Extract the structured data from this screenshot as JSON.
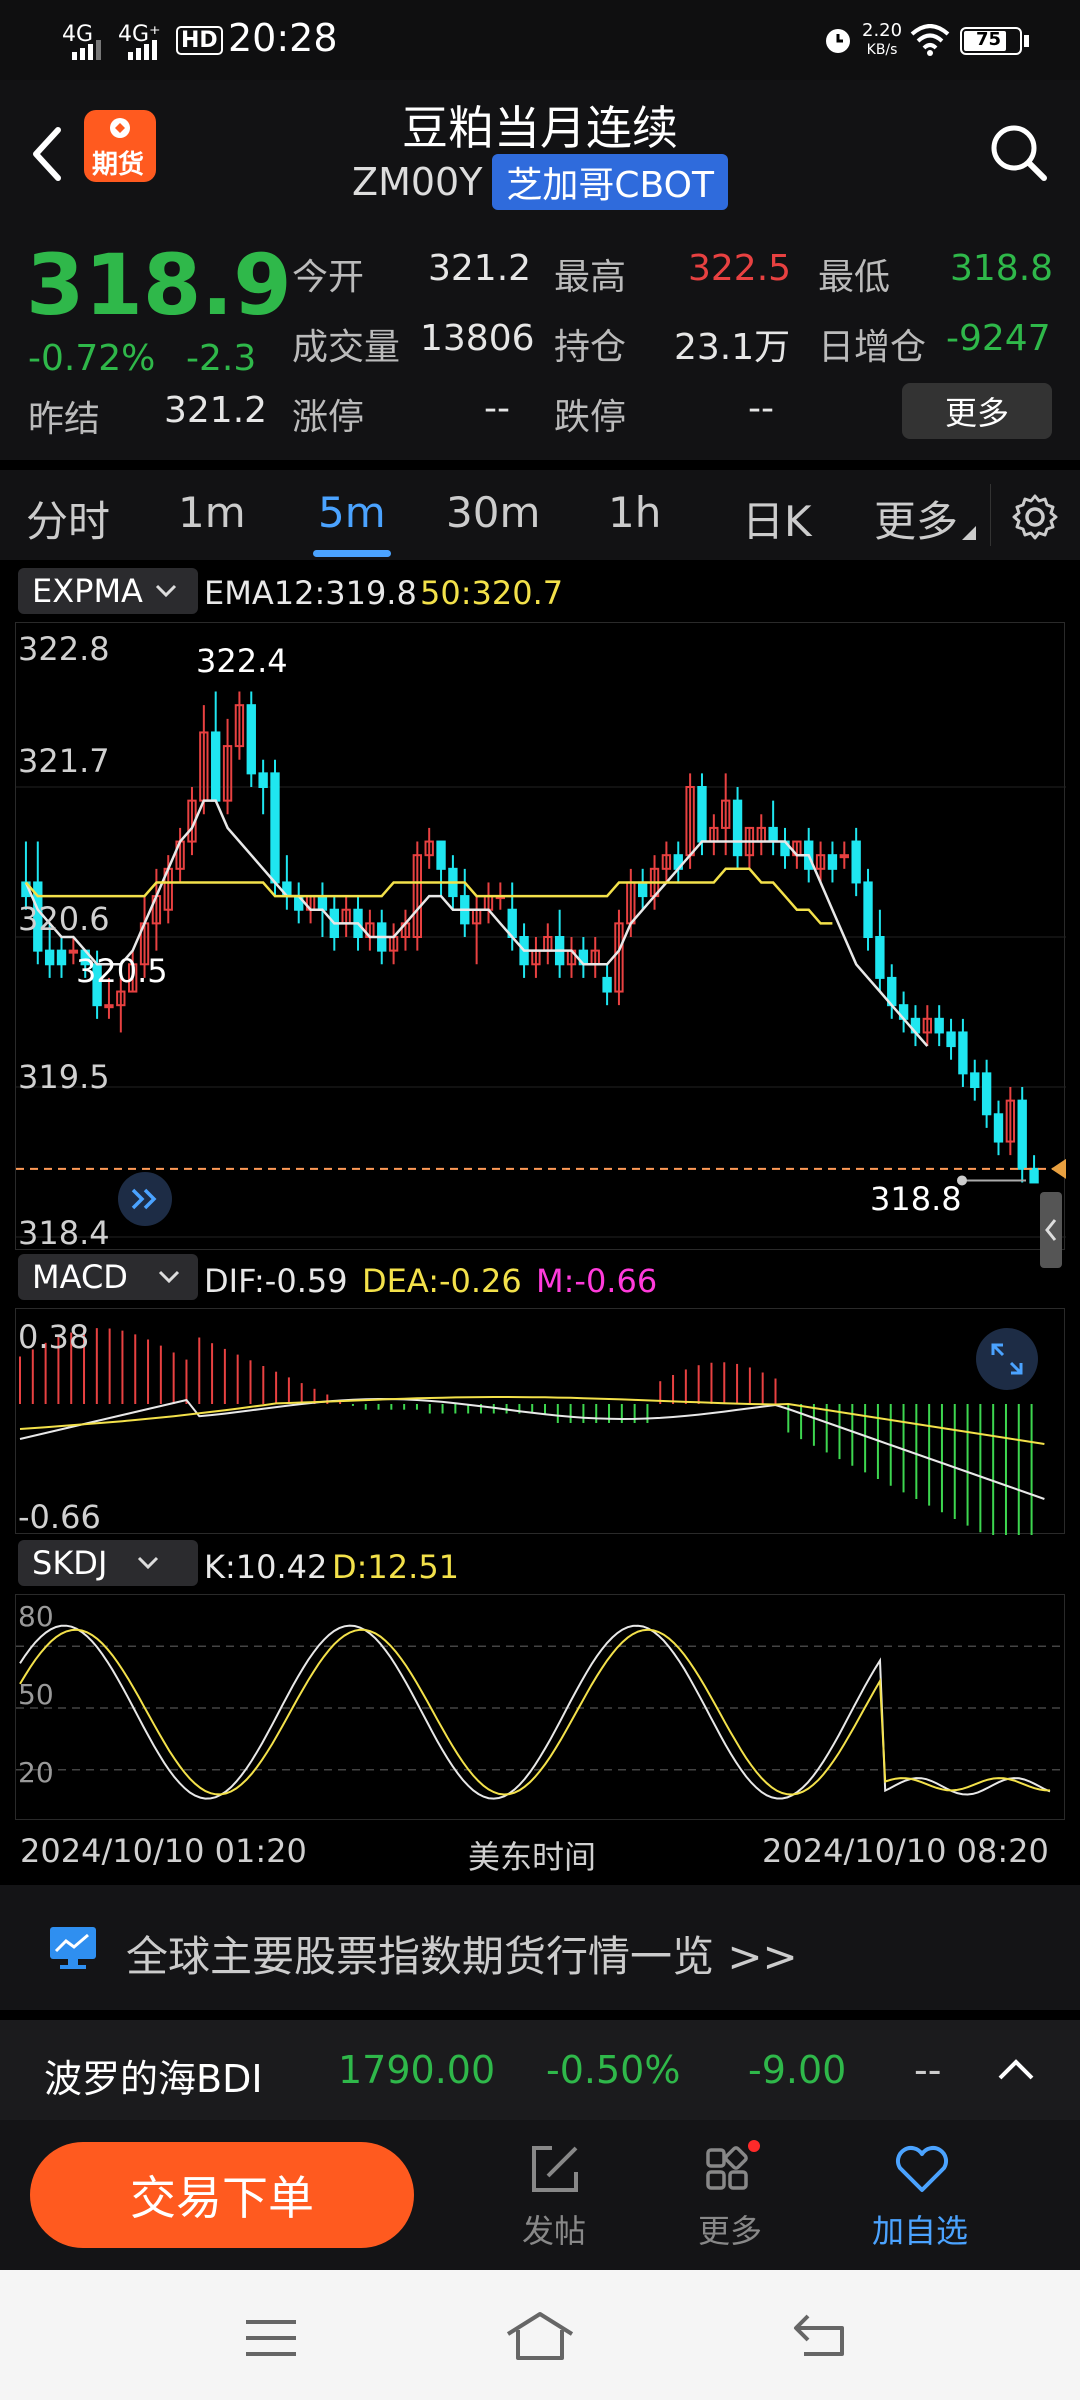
{
  "status_bar": {
    "net1": "4G",
    "net2": "4G⁺",
    "hd": "HD",
    "time": "20:28",
    "speed_value": "2.20",
    "speed_unit": "KB/s",
    "battery": "75"
  },
  "header": {
    "title": "豆粕当月连续",
    "code": "ZM00Y",
    "exchange": "芝加哥CBOT",
    "logo_label": "期货"
  },
  "quote": {
    "price": "318.9",
    "change_pct": "-0.72%",
    "change": "-2.3",
    "prev_settle_label": "昨结",
    "prev_settle": "321.2",
    "open_label": "今开",
    "open": "321.2",
    "high_label": "最高",
    "high": "322.5",
    "low_label": "最低",
    "low": "318.8",
    "volume_label": "成交量",
    "volume": "13806",
    "oi_label": "持仓",
    "oi": "23.1万",
    "oi_change_label": "日增仓",
    "oi_change": "-9247",
    "limit_up_label": "涨停",
    "limit_up": "--",
    "limit_down_label": "跌停",
    "limit_down": "--",
    "more_button": "更多"
  },
  "tabs": [
    "分时",
    "1m",
    "5m",
    "30m",
    "1h",
    "日K",
    "更多"
  ],
  "active_tab": "5m",
  "main_indicator": {
    "name": "EXPMA",
    "ema12_label": "EMA12:319.8",
    "ema50_label": "50:320.7"
  },
  "macd": {
    "name": "MACD",
    "dif": "DIF:-0.59",
    "dea": "DEA:-0.26",
    "m": "M:-0.66",
    "top_label": "0.38",
    "bottom_label": "-0.66"
  },
  "skdj": {
    "name": "SKDJ",
    "k": "K:10.42",
    "d": "D:12.51",
    "levels": [
      "80",
      "50",
      "20"
    ]
  },
  "time_axis": {
    "start": "2024/10/10 01:20",
    "middle": "美东时间",
    "end": "2024/10/10 08:20"
  },
  "colors": {
    "up": "#e84141",
    "down": "#1fe6f0",
    "ema12": "#e8e8e8",
    "ema50": "#f3e14a",
    "accent": "#4ba3ff",
    "green": "#2fb84a",
    "trade_button": "#ff5a1f"
  },
  "chart_data": {
    "type": "candlestick",
    "interval": "5m",
    "y_ticks": [
      "322.8",
      "321.7",
      "320.6",
      "319.5",
      "318.4"
    ],
    "ylim": [
      318.4,
      322.8
    ],
    "high_label": "322.4",
    "low_label": "320.5",
    "last_price_label": "318.8",
    "candles": [
      {
        "o": 321.0,
        "h": 321.3,
        "c": 320.9,
        "l": 320.8
      },
      {
        "o": 321.0,
        "h": 321.3,
        "c": 320.5,
        "l": 320.4
      },
      {
        "o": 320.5,
        "h": 320.7,
        "c": 320.4,
        "l": 320.3
      },
      {
        "o": 320.5,
        "h": 320.6,
        "c": 320.4,
        "l": 320.3
      },
      {
        "o": 320.5,
        "h": 320.6,
        "c": 320.5,
        "l": 320.4
      },
      {
        "o": 320.5,
        "h": 320.5,
        "c": 320.4,
        "l": 320.3
      },
      {
        "o": 320.4,
        "h": 320.5,
        "c": 320.1,
        "l": 320.0
      },
      {
        "o": 320.1,
        "h": 320.3,
        "c": 320.1,
        "l": 320.0
      },
      {
        "o": 320.1,
        "h": 320.3,
        "c": 320.2,
        "l": 319.9
      },
      {
        "o": 320.2,
        "h": 320.5,
        "c": 320.4,
        "l": 320.2
      },
      {
        "o": 320.4,
        "h": 320.9,
        "c": 320.7,
        "l": 320.3
      },
      {
        "o": 320.7,
        "h": 321.1,
        "c": 320.9,
        "l": 320.5
      },
      {
        "o": 320.8,
        "h": 321.2,
        "c": 321.1,
        "l": 320.7
      },
      {
        "o": 321.1,
        "h": 321.4,
        "c": 321.3,
        "l": 321.0
      },
      {
        "o": 321.3,
        "h": 321.7,
        "c": 321.6,
        "l": 321.2
      },
      {
        "o": 321.6,
        "h": 322.3,
        "c": 322.1,
        "l": 321.5
      },
      {
        "o": 322.1,
        "h": 322.4,
        "c": 321.6,
        "l": 321.6
      },
      {
        "o": 321.6,
        "h": 322.2,
        "c": 322.0,
        "l": 321.5
      },
      {
        "o": 322.0,
        "h": 322.4,
        "c": 322.3,
        "l": 321.9
      },
      {
        "o": 322.3,
        "h": 322.4,
        "c": 321.8,
        "l": 321.7
      },
      {
        "o": 321.8,
        "h": 321.9,
        "c": 321.7,
        "l": 321.5
      },
      {
        "o": 321.8,
        "h": 321.9,
        "c": 321.0,
        "l": 320.9
      },
      {
        "o": 321.0,
        "h": 321.2,
        "c": 320.9,
        "l": 320.8
      },
      {
        "o": 320.9,
        "h": 321.0,
        "c": 320.8,
        "l": 320.7
      },
      {
        "o": 320.8,
        "h": 320.9,
        "c": 320.9,
        "l": 320.7
      },
      {
        "o": 320.9,
        "h": 321.0,
        "c": 320.8,
        "l": 320.6
      },
      {
        "o": 320.8,
        "h": 320.9,
        "c": 320.6,
        "l": 320.5
      },
      {
        "o": 320.7,
        "h": 320.9,
        "c": 320.8,
        "l": 320.6
      },
      {
        "o": 320.8,
        "h": 320.9,
        "c": 320.6,
        "l": 320.5
      },
      {
        "o": 320.6,
        "h": 320.8,
        "c": 320.7,
        "l": 320.5
      },
      {
        "o": 320.7,
        "h": 320.8,
        "c": 320.5,
        "l": 320.4
      },
      {
        "o": 320.5,
        "h": 320.7,
        "c": 320.6,
        "l": 320.4
      },
      {
        "o": 320.6,
        "h": 320.8,
        "c": 320.7,
        "l": 320.5
      },
      {
        "o": 320.6,
        "h": 321.3,
        "c": 321.2,
        "l": 320.5
      },
      {
        "o": 321.2,
        "h": 321.4,
        "c": 321.3,
        "l": 321.1
      },
      {
        "o": 321.3,
        "h": 321.3,
        "c": 321.1,
        "l": 320.9
      },
      {
        "o": 321.1,
        "h": 321.2,
        "c": 320.9,
        "l": 320.8
      },
      {
        "o": 320.9,
        "h": 321.1,
        "c": 320.7,
        "l": 320.6
      },
      {
        "o": 320.7,
        "h": 320.9,
        "c": 320.8,
        "l": 320.4
      },
      {
        "o": 320.8,
        "h": 321.0,
        "c": 320.9,
        "l": 320.7
      },
      {
        "o": 320.9,
        "h": 321.0,
        "c": 320.9,
        "l": 320.8
      },
      {
        "o": 320.8,
        "h": 321.0,
        "c": 320.6,
        "l": 320.5
      },
      {
        "o": 320.6,
        "h": 320.7,
        "c": 320.4,
        "l": 320.3
      },
      {
        "o": 320.4,
        "h": 320.6,
        "c": 320.5,
        "l": 320.3
      },
      {
        "o": 320.5,
        "h": 320.7,
        "c": 320.6,
        "l": 320.4
      },
      {
        "o": 320.6,
        "h": 320.8,
        "c": 320.4,
        "l": 320.3
      },
      {
        "o": 320.4,
        "h": 320.6,
        "c": 320.5,
        "l": 320.3
      },
      {
        "o": 320.5,
        "h": 320.6,
        "c": 320.4,
        "l": 320.3
      },
      {
        "o": 320.4,
        "h": 320.6,
        "c": 320.5,
        "l": 320.3
      },
      {
        "o": 320.3,
        "h": 320.4,
        "c": 320.2,
        "l": 320.1
      },
      {
        "o": 320.2,
        "h": 320.8,
        "c": 320.7,
        "l": 320.1
      },
      {
        "o": 320.7,
        "h": 321.1,
        "c": 321.0,
        "l": 320.6
      },
      {
        "o": 321.0,
        "h": 321.1,
        "c": 320.9,
        "l": 320.8
      },
      {
        "o": 320.9,
        "h": 321.2,
        "c": 321.1,
        "l": 320.8
      },
      {
        "o": 321.1,
        "h": 321.3,
        "c": 321.2,
        "l": 321.0
      },
      {
        "o": 321.2,
        "h": 321.3,
        "c": 321.1,
        "l": 321.0
      },
      {
        "o": 321.2,
        "h": 321.8,
        "c": 321.7,
        "l": 321.1
      },
      {
        "o": 321.7,
        "h": 321.8,
        "c": 321.3,
        "l": 321.2
      },
      {
        "o": 321.3,
        "h": 321.5,
        "c": 321.4,
        "l": 321.2
      },
      {
        "o": 321.4,
        "h": 321.8,
        "c": 321.6,
        "l": 321.2
      },
      {
        "o": 321.6,
        "h": 321.7,
        "c": 321.2,
        "l": 321.1
      },
      {
        "o": 321.2,
        "h": 321.4,
        "c": 321.4,
        "l": 321.1
      },
      {
        "o": 321.3,
        "h": 321.5,
        "c": 321.4,
        "l": 321.2
      },
      {
        "o": 321.4,
        "h": 321.6,
        "c": 321.3,
        "l": 321.2
      },
      {
        "o": 321.3,
        "h": 321.4,
        "c": 321.2,
        "l": 321.1
      },
      {
        "o": 321.2,
        "h": 321.3,
        "c": 321.3,
        "l": 321.1
      },
      {
        "o": 321.3,
        "h": 321.4,
        "c": 321.1,
        "l": 321.0
      },
      {
        "o": 321.1,
        "h": 321.3,
        "c": 321.2,
        "l": 321.0
      },
      {
        "o": 321.2,
        "h": 321.3,
        "c": 321.1,
        "l": 321.0
      },
      {
        "o": 321.2,
        "h": 321.3,
        "c": 321.2,
        "l": 321.1
      },
      {
        "o": 321.3,
        "h": 321.4,
        "c": 321.0,
        "l": 320.9
      },
      {
        "o": 321.0,
        "h": 321.1,
        "c": 320.6,
        "l": 320.5
      },
      {
        "o": 320.6,
        "h": 320.8,
        "c": 320.3,
        "l": 320.2
      },
      {
        "o": 320.3,
        "h": 320.4,
        "c": 320.1,
        "l": 320.0
      },
      {
        "o": 320.1,
        "h": 320.2,
        "c": 320.0,
        "l": 319.9
      },
      {
        "o": 320.0,
        "h": 320.1,
        "c": 319.9,
        "l": 319.8
      },
      {
        "o": 319.9,
        "h": 320.1,
        "c": 320.0,
        "l": 319.8
      },
      {
        "o": 320.0,
        "h": 320.1,
        "c": 319.9,
        "l": 319.8
      },
      {
        "o": 319.9,
        "h": 320.0,
        "c": 319.8,
        "l": 319.7
      },
      {
        "o": 319.9,
        "h": 320.0,
        "c": 319.6,
        "l": 319.5
      },
      {
        "o": 319.6,
        "h": 319.7,
        "c": 319.5,
        "l": 319.4
      },
      {
        "o": 319.6,
        "h": 319.7,
        "c": 319.3,
        "l": 319.2
      },
      {
        "o": 319.3,
        "h": 319.4,
        "c": 319.1,
        "l": 319.0
      },
      {
        "o": 319.1,
        "h": 319.5,
        "c": 319.4,
        "l": 319.0
      },
      {
        "o": 319.4,
        "h": 319.5,
        "c": 318.9,
        "l": 318.8
      },
      {
        "o": 318.9,
        "h": 319.0,
        "c": 318.8,
        "l": 318.8
      }
    ],
    "series": [
      {
        "name": "EMA12",
        "values": [
          321.0,
          320.8,
          320.7,
          320.6,
          320.6,
          320.5,
          320.4,
          320.4,
          320.4,
          320.5,
          320.7,
          320.9,
          321.1,
          321.3,
          321.4,
          321.6,
          321.6,
          321.4,
          321.3,
          321.2,
          321.1,
          321.0,
          320.9,
          320.9,
          320.8,
          320.8,
          320.7,
          320.7,
          320.7,
          320.6,
          320.6,
          320.6,
          320.7,
          320.8,
          320.9,
          320.9,
          320.8,
          320.8,
          320.8,
          320.8,
          320.7,
          320.6,
          320.5,
          320.5,
          320.5,
          320.5,
          320.5,
          320.4,
          320.4,
          320.4,
          320.5,
          320.7,
          320.8,
          320.9,
          321.0,
          321.1,
          321.2,
          321.3,
          321.3,
          321.3,
          321.3,
          321.3,
          321.3,
          321.3,
          321.3,
          321.2,
          321.2,
          321.0,
          320.8,
          320.6,
          320.4,
          320.3,
          320.2,
          320.1,
          320.0,
          319.9,
          319.8
        ]
      },
      {
        "name": "50",
        "values": [
          321.0,
          320.9,
          320.9,
          320.9,
          320.9,
          320.9,
          320.9,
          320.9,
          320.9,
          320.9,
          320.9,
          321.0,
          321.0,
          321.0,
          321.0,
          321.0,
          321.0,
          321.0,
          321.0,
          321.0,
          321.0,
          320.9,
          320.9,
          320.9,
          320.9,
          320.9,
          320.9,
          320.9,
          320.9,
          320.9,
          320.9,
          321.0,
          321.0,
          321.0,
          321.0,
          321.0,
          321.0,
          321.0,
          320.9,
          320.9,
          320.9,
          320.9,
          320.9,
          320.9,
          320.9,
          320.9,
          320.9,
          320.9,
          320.9,
          320.9,
          321.0,
          321.0,
          321.0,
          321.0,
          321.0,
          321.0,
          321.0,
          321.0,
          321.0,
          321.1,
          321.1,
          321.1,
          321.0,
          321.0,
          320.9,
          320.8,
          320.8,
          320.7,
          320.7
        ]
      }
    ]
  },
  "banner": {
    "text": "全球主要股票指数期货行情一览 >>"
  },
  "ticker": {
    "name": "波罗的海BDI",
    "value": "1790.00",
    "pct": "-0.50%",
    "change": "-9.00",
    "extra": "--"
  },
  "actions": {
    "trade": "交易下单",
    "post": "发帖",
    "more": "更多",
    "watch": "加自选"
  },
  "nav": {
    "menu": "menu-icon",
    "home": "home-icon",
    "back": "back-icon"
  }
}
